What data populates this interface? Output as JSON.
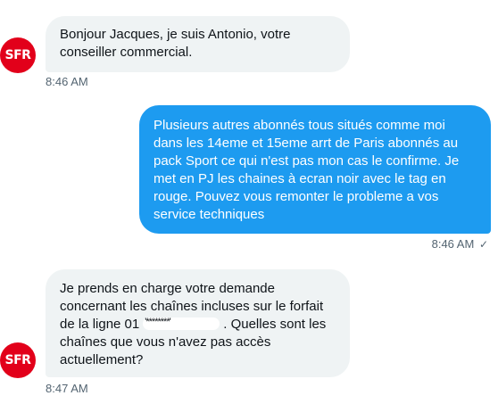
{
  "messages": [
    {
      "avatar_text": "SFR",
      "lines": [
        "Bonjour Jacques, je suis Antonio, votre",
        "conseiller commercial."
      ],
      "time": "8:46 AM"
    },
    {
      "lines": [
        "Plusieurs autres abonnés tous situés comme moi",
        "dans les 14eme et 15eme arrt de Paris abonnés au",
        "pack Sport ce qui n'est pas mon cas le confirme. Je",
        "met en PJ les chaines à ecran noir avec le tag en",
        "rouge. Pouvez vous remonter le probleme a vos",
        "service techniques"
      ],
      "time": "8:46 AM",
      "status_icon": "✓"
    },
    {
      "avatar_text": "SFR",
      "lines": [
        "Je prends en charge votre demande",
        "concernant les chaînes incluses sur le forfait"
      ],
      "line3_prefix": "de la ligne 01",
      "redacted_text": "'********'",
      "line3_suffix": ". Quelles sont les",
      "lines_end": [
        "chaînes que vous n'avez pas accès",
        "actuellement?"
      ],
      "time": "8:47 AM"
    }
  ],
  "colors": {
    "brand": "#e2001a",
    "outgoing": "#1d9bf0",
    "incoming": "#eff3f4"
  }
}
